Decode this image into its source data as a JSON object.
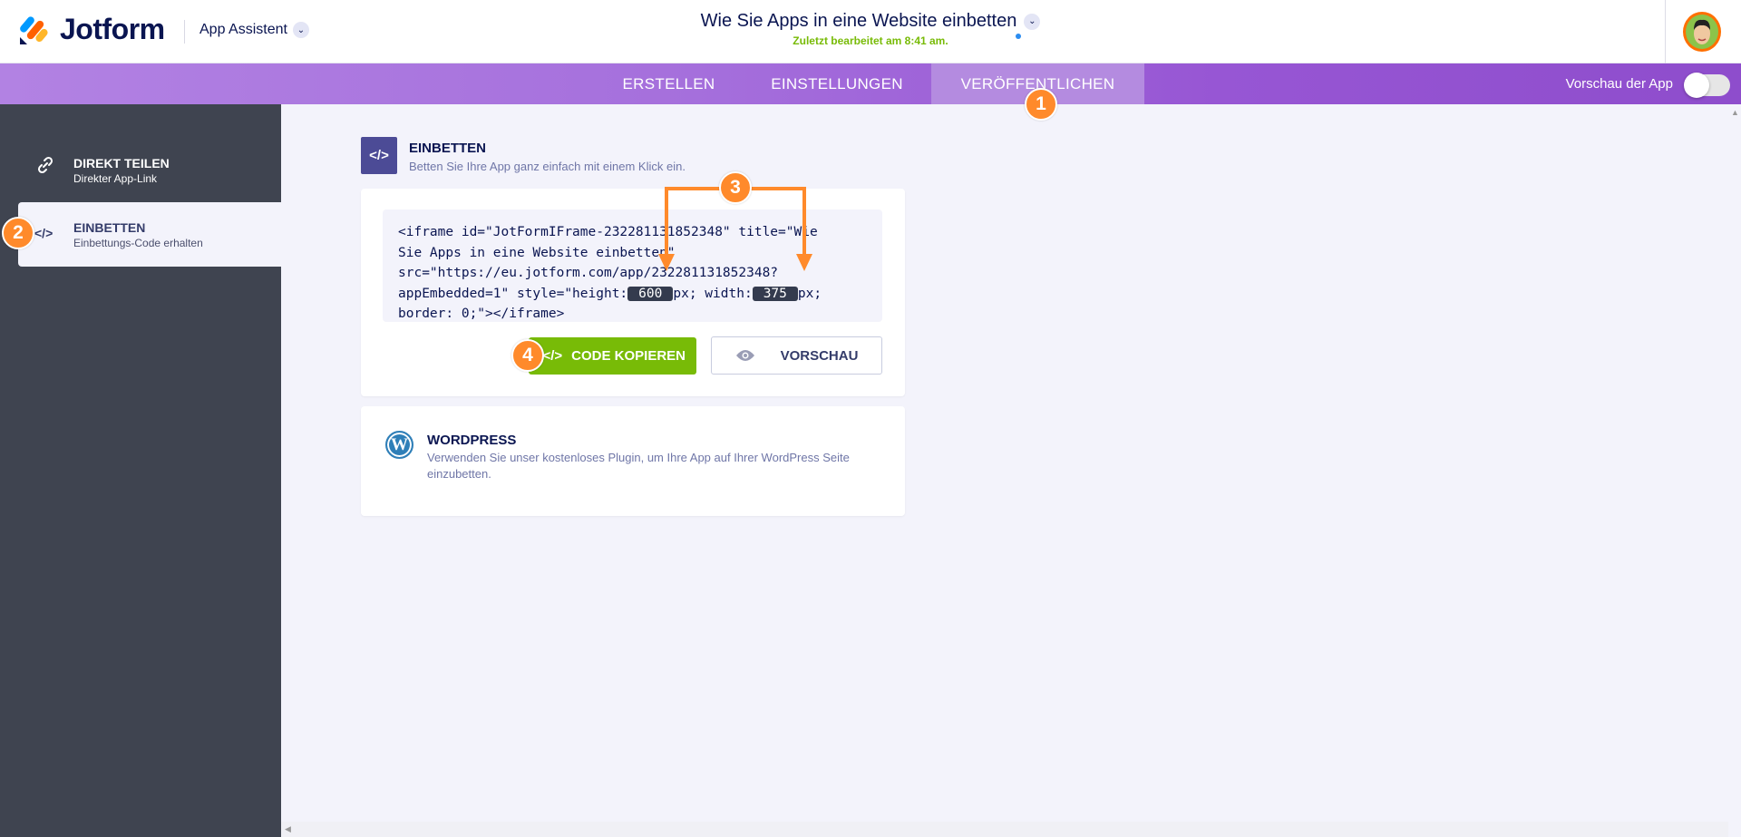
{
  "header": {
    "brand": "Jotform",
    "app_menu": "App Assistent",
    "doc_title": "Wie Sie Apps in eine Website einbetten",
    "last_edited": "Zuletzt bearbeitet am 8:41 am."
  },
  "nav": {
    "tabs": [
      {
        "label": "ERSTELLEN"
      },
      {
        "label": "EINSTELLUNGEN"
      },
      {
        "label": "VERÖFFENTLICHEN",
        "active": true
      }
    ],
    "preview_label": "Vorschau der App",
    "preview_on": false
  },
  "sidebar": {
    "items": [
      {
        "icon": "link-icon",
        "glyph": "🔗",
        "title": "DIREKT TEILEN",
        "subtitle": "Direkter App-Link"
      },
      {
        "icon": "code-icon",
        "glyph": "</>",
        "title": "EINBETTEN",
        "subtitle": "Einbettungs-Code erhalten",
        "active": true
      }
    ]
  },
  "main": {
    "section_icon": "</>",
    "section_title": "EINBETTEN",
    "section_subtitle": "Betten Sie Ihre App ganz einfach mit einem Klick ein.",
    "code": {
      "line1": "<iframe id=\"JotFormIFrame-232281131852348\" title=\"Wie",
      "line2": "Sie Apps in eine Website einbetten\"",
      "line3": "src=\"https://eu.jotform.com/app/232281131852348?",
      "line4_a": "appEmbedded=1\" style=\"height:",
      "height": "600",
      "line4_b": "px; width:",
      "width": "375",
      "line4_c": "px;",
      "line5": "border: 0;\"></iframe>"
    },
    "copy_icon": "</>",
    "copy_button": "CODE KOPIEREN",
    "preview_button": "VORSCHAU",
    "wordpress": {
      "title": "WORDPRESS",
      "description": "Verwenden Sie unser kostenloses Plugin, um Ihre App auf Ihrer WordPress Seite einzubetten."
    }
  },
  "annotations": [
    "1",
    "2",
    "3",
    "4"
  ],
  "colors": {
    "accent_purple": "#9756d4",
    "green": "#78bb07",
    "badge_orange": "#ff8a2b",
    "sidebar": "#3f4450"
  }
}
